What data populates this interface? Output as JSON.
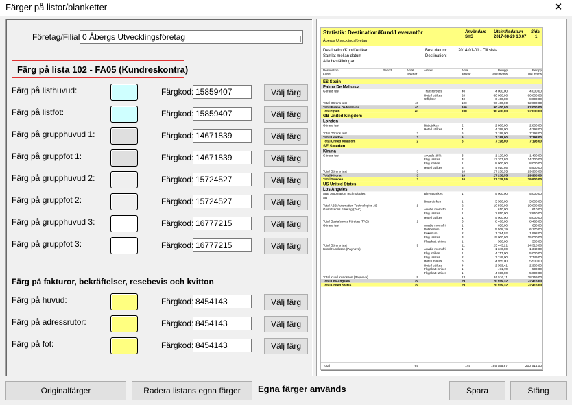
{
  "window": {
    "title": "Färger på listor/blanketter",
    "close_glyph": "✕"
  },
  "company": {
    "label": "Företag/Filial:",
    "value": "0  Åbergs Utvecklingsföretag"
  },
  "list_section": {
    "title": "Färg på lista 102 - FA05 (Kundreskontra)"
  },
  "invoice_section": {
    "title": "Färg på fakturor, bekräftelser, resebevis och kvitton"
  },
  "code_label": "Färgkod:",
  "choose_label": "Välj färg",
  "rows": [
    {
      "label": "Färg på listhuvud:",
      "code": "15859407",
      "color": "#cfffff"
    },
    {
      "label": "Färg på listfot:",
      "code": "15859407",
      "color": "#cfffff"
    },
    {
      "label": "Färg på grupphuvud 1:",
      "code": "14671839",
      "color": "#dfdfdf"
    },
    {
      "label": "Färg på gruppfot 1:",
      "code": "14671839",
      "color": "#dfdfdf"
    },
    {
      "label": "Färg på grupphuvud 2:",
      "code": "15724527",
      "color": "#efefef"
    },
    {
      "label": "Färg på gruppfot 2:",
      "code": "15724527",
      "color": "#efefef"
    },
    {
      "label": "Färg på grupphuvud 3:",
      "code": "16777215",
      "color": "#ffffff"
    },
    {
      "label": "Färg på gruppfot 3:",
      "code": "16777215",
      "color": "#ffffff"
    },
    {
      "label": "Färg på huvud:",
      "code": "8454143",
      "color": "#ffff80"
    },
    {
      "label": "Färg på adressrutor:",
      "code": "8454143",
      "color": "#ffff80"
    },
    {
      "label": "Färg på fot:",
      "code": "8454143",
      "color": "#ffff80"
    }
  ],
  "buttons": {
    "original": "Originalfärger",
    "clear": "Radera listans egna färger",
    "save": "Spara",
    "close": "Stäng"
  },
  "status": "Egna färger används",
  "report": {
    "title": "Statistik: Destination/Kund/Leverantör",
    "user_label": "Användare",
    "user": "SYS",
    "date_label": "Utskriftsdatum",
    "date": "2017-08-29 10.07",
    "page_label": "Sida",
    "page": "1",
    "company": "Åbergs Utvecklingsföretag",
    "info_left": [
      "Destination/Kund/Artikar",
      "Samlat mellan datum",
      "Alla beställningar"
    ],
    "info_mid_labels": [
      "Best datum:",
      "Destination:"
    ],
    "info_mid_values": [
      "2014-01-01  -  Till sista",
      ""
    ],
    "col_headers": [
      "Destination\nKund",
      "Period",
      "Antal\nresenär",
      "Artikel",
      "Antal\nartiklar",
      "Belopp\nexkl moms",
      "Belopp\ninkl moms"
    ],
    "rows": [
      [
        "grp",
        "ES   Spain"
      ],
      [
        "sub",
        "Palma De Mallorca"
      ],
      [
        "d",
        "Görans test",
        "",
        "",
        "Transferbuss",
        "40",
        "4 000,00",
        "4 000,00"
      ],
      [
        "d",
        "",
        "",
        "",
        "Hotell utrikes",
        "20",
        "80 000,00",
        "80 000,00"
      ],
      [
        "d",
        "",
        "",
        "",
        "Utflykter",
        "40",
        "6 400,00",
        "8 000,00"
      ],
      [
        "d",
        "Total Görans test",
        "",
        "40",
        "",
        "100",
        "90 400,00",
        "92 000,00"
      ],
      [
        "tg",
        "Total Palma De Mallorca",
        "",
        "40",
        "",
        "100",
        "90 400,00",
        "92 000,00"
      ],
      [
        "ty",
        "Total Spain",
        "",
        "40",
        "",
        "100",
        "90 400,00",
        "92 000,00"
      ],
      [
        "grp",
        "GB   United Kingdom"
      ],
      [
        "sub",
        "London"
      ],
      [
        "d",
        "Görans test",
        "",
        "",
        "Båt utrikes",
        "2",
        "2 800,00",
        "2 800,00"
      ],
      [
        "d",
        "",
        "",
        "",
        "Hotell utrikes",
        "4",
        "4 398,00",
        "4 398,00"
      ],
      [
        "d",
        "Total Görans test",
        "",
        "2",
        "",
        "6",
        "7 198,00",
        "7 198,00"
      ],
      [
        "tg",
        "Total London",
        "",
        "2",
        "",
        "6",
        "7 198,00",
        "7 198,00"
      ],
      [
        "ty",
        "Total United Kingdom",
        "",
        "2",
        "",
        "6",
        "7 198,00",
        "7 198,00"
      ],
      [
        "grp",
        "SE   Sweden"
      ],
      [
        "sub",
        "Kiruna"
      ],
      [
        "d",
        "Görans test",
        "",
        "",
        "Avvoda 25%",
        "3",
        "1 120,00",
        "1 400,00"
      ],
      [
        "d",
        "",
        "",
        "",
        "Flyg utrikes",
        "3",
        "13 207,80",
        "14 700,00"
      ],
      [
        "d",
        "",
        "",
        "",
        "Flyg inrikes",
        "1",
        "8 000,00",
        "8 000,00"
      ],
      [
        "d",
        "",
        "",
        "",
        "Hotell utrikes",
        "3",
        "4 910,95",
        "5 500,00"
      ],
      [
        "d",
        "Total Görans test",
        "",
        "3",
        "",
        "10",
        "27 238,55",
        "29 900,00"
      ],
      [
        "tg",
        "Total Kiruna",
        "",
        "3",
        "",
        "10",
        "27 238,55",
        "29 900,00"
      ],
      [
        "ty",
        "Total Sweden",
        "",
        "3",
        "",
        "10",
        "27 238,55",
        "29 900,00"
      ],
      [
        "grp",
        "US   United States"
      ],
      [
        "sub",
        "Los Angeles"
      ],
      [
        "d",
        "ABB Automation Technologies",
        "",
        "",
        "Biltyra utrikes",
        "1",
        "5 000,00",
        "5 000,00"
      ],
      [
        "d",
        "AB",
        "",
        "",
        "",
        "",
        "",
        ""
      ],
      [
        "d",
        "",
        "",
        "",
        "Buss utrikes",
        "1",
        "5 500,00",
        "5 000,00"
      ],
      [
        "d",
        "Total ABB Automation Technologies AB",
        "",
        "1",
        "",
        "2",
        "10 500,00",
        "10 000,00"
      ],
      [
        "d",
        "Gustafssons Företag (TAC)",
        "",
        "",
        "Anvdie momsfri",
        "1",
        "610,00",
        "610,00"
      ],
      [
        "d",
        "",
        "",
        "",
        "Flyg utrikes",
        "1",
        "2 850,00",
        "2 850,00"
      ],
      [
        "d",
        "",
        "",
        "",
        "Hotell utrikes",
        "1",
        "5 000,00",
        "5 000,00"
      ],
      [
        "d",
        "Total Gustafssons Företag (TAC)",
        "",
        "1",
        "",
        "3",
        "8 460,00",
        "8 460,00"
      ],
      [
        "d",
        "Görans test",
        "",
        "",
        "Anvdie momsfri",
        "1",
        "650,00",
        "650,00"
      ],
      [
        "d",
        "",
        "",
        "",
        "Dubbelrum",
        "4",
        "5 508,19",
        "6 170,00"
      ],
      [
        "d",
        "",
        "",
        "",
        "Enkelrum",
        "2",
        "1 784,02",
        "1 998,00"
      ],
      [
        "d",
        "",
        "",
        "",
        "Flyg utrikes",
        "3",
        "15 000,00",
        "15 000,00"
      ],
      [
        "d",
        "",
        "",
        "",
        "Flygskatt utrikes",
        "1",
        "500,00",
        "500,00"
      ],
      [
        "d",
        "Total Görans test",
        "",
        "9",
        "",
        "11",
        "23 443,21",
        "24 318,00"
      ],
      [
        "d",
        "Kund Kundsson (Paynova)",
        "",
        "",
        "Anvdie momsfri",
        "1",
        "1 340,00",
        "1 340,00"
      ],
      [
        "d",
        "",
        "",
        "",
        "Flyg inrikes",
        "1",
        "4 717,00",
        "5 000,00"
      ],
      [
        "d",
        "",
        "",
        "",
        "Flyg utrikes",
        "2",
        "7 749,00",
        "7 749,00"
      ],
      [
        "d",
        "",
        "",
        "",
        "Hotell inrikes",
        "3",
        "4 955,00",
        "5 500,00"
      ],
      [
        "d",
        "",
        "",
        "",
        "Hotell utrikes",
        "4",
        "2 589,41",
        "2 900,00"
      ],
      [
        "d",
        "",
        "",
        "",
        "Flygskatt inrikes",
        "1",
        "471,70",
        "500,00"
      ],
      [
        "d",
        "",
        "",
        "",
        "Flygskatt utrikes",
        "1",
        "4 690,00",
        "5 000,00"
      ],
      [
        "d",
        "Total Kund Kundsson (Paynova)",
        "",
        "9",
        "",
        "13",
        "26 516,11",
        "28 259,00"
      ],
      [
        "tg",
        "Total Los Angeles",
        "",
        "29",
        "",
        "29",
        "70 919,32",
        "72 416,00"
      ],
      [
        "ty",
        "Total United States",
        "",
        "29",
        "",
        "29",
        "70 919,32",
        "72 416,00"
      ]
    ],
    "grand_total": [
      "Total",
      "",
      "65",
      "",
      "145",
      "195 755,87",
      "200 514,00"
    ]
  }
}
